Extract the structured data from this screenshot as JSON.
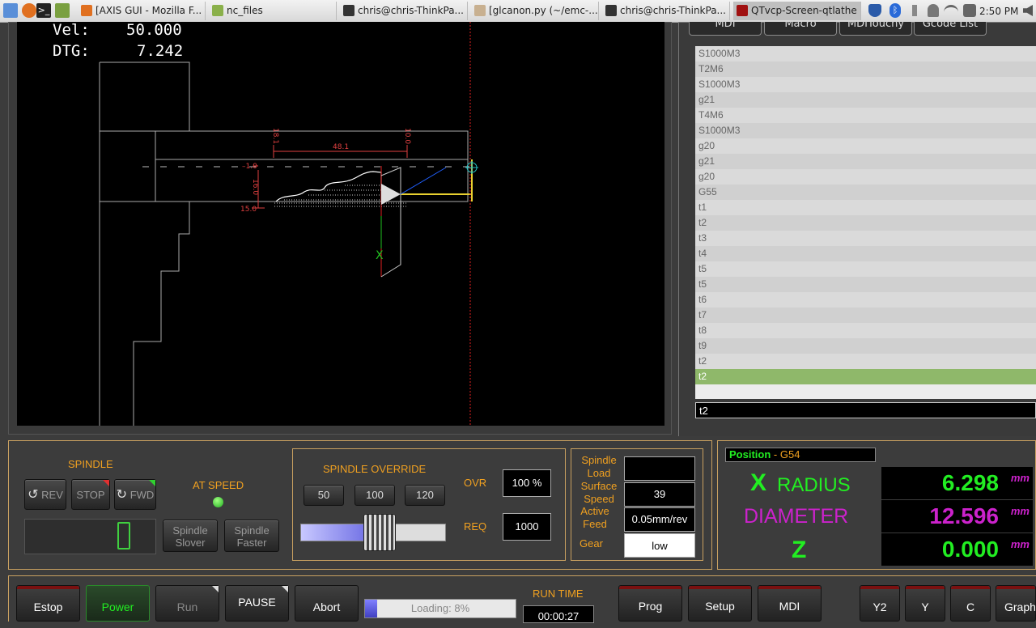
{
  "taskbar": {
    "tasks": [
      {
        "label": "[AXIS GUI - Mozilla F...",
        "icon": "firefox-icon"
      },
      {
        "label": "nc_files",
        "icon": "folder-icon"
      },
      {
        "label": "chris@chris-ThinkPa...",
        "icon": "terminal-icon"
      },
      {
        "label": "[glcanon.py (~/emc-...",
        "icon": "text-editor-icon"
      },
      {
        "label": "chris@chris-ThinkPa...",
        "icon": "terminal-icon"
      },
      {
        "label": "QTvcp-Screen-qtlathe",
        "icon": "qtvcp-icon"
      }
    ],
    "clock": "2:50 PM"
  },
  "graphics": {
    "vel_label": "Vel:",
    "vel_value": "50.000",
    "dtg_label": "DTG:",
    "dtg_value": "7.242",
    "dims": {
      "d1": "18.1",
      "d2": "48.1",
      "d3": "10.0",
      "d4": "1.0",
      "d5": "16.0",
      "d6": "15.0",
      "axis": "X"
    }
  },
  "right_tabs": [
    "MDI",
    "Macro",
    "MDITouchy",
    "Gcode List"
  ],
  "gcode_list": [
    "S1000M3",
    "T2M6",
    "S1000M3",
    "g21",
    "T4M6",
    "S1000M3",
    "g20",
    "g21",
    "g20",
    "G55",
    "t1",
    "t2",
    "t3",
    "t4",
    "t5",
    "t5",
    "t6",
    "t7",
    "t8",
    "t9",
    "t2",
    "t2"
  ],
  "gcode_selected_index": 21,
  "mdi_entry": "t2",
  "spindle": {
    "title": "SPINDLE",
    "rev": "REV",
    "stop": "STOP",
    "fwd": "FWD",
    "at_speed": "AT SPEED",
    "slower": "Spindle Slover",
    "faster": "Spindle Faster"
  },
  "override": {
    "title": "SPINDLE OVERRIDE",
    "presets": [
      "50",
      "100",
      "120"
    ],
    "ovr_label": "OVR",
    "ovr_value": "100 %",
    "req_label": "REQ",
    "req_value": "1000",
    "slider_fraction": 0.55
  },
  "info": {
    "load_label": "Spindle Load",
    "load_value": "",
    "surface_label": "Surface Speed",
    "surface_value": "39",
    "feed_label": "Active Feed",
    "feed_value": "0.05mm/rev",
    "gear_label": "Gear",
    "gear_value": "low"
  },
  "position": {
    "title": "Position",
    "system": "- G54",
    "x_letter": "X",
    "x_mode": "RADIUS",
    "x_value": "6.298",
    "dia_label": "DIAMETER",
    "dia_value": "12.596",
    "z_letter": "Z",
    "z_value": "0.000",
    "unit": "mm"
  },
  "bottom": {
    "estop": "Estop",
    "power": "Power",
    "run": "Run",
    "pause": "PAUSE",
    "abort": "Abort",
    "loading": "Loading: 8%",
    "loading_fraction": 0.08,
    "runtime_label": "RUN TIME",
    "runtime_value": "00:00:27",
    "prog": "Prog",
    "setup": "Setup",
    "mdi": "MDI",
    "y2": "Y2",
    "y": "Y",
    "c": "C",
    "graph": "Graph"
  },
  "colors": {
    "accent": "#f0a020",
    "dro_green": "#22ee22",
    "diameter_purple": "#cc22cc",
    "selection": "#8fb86a"
  }
}
